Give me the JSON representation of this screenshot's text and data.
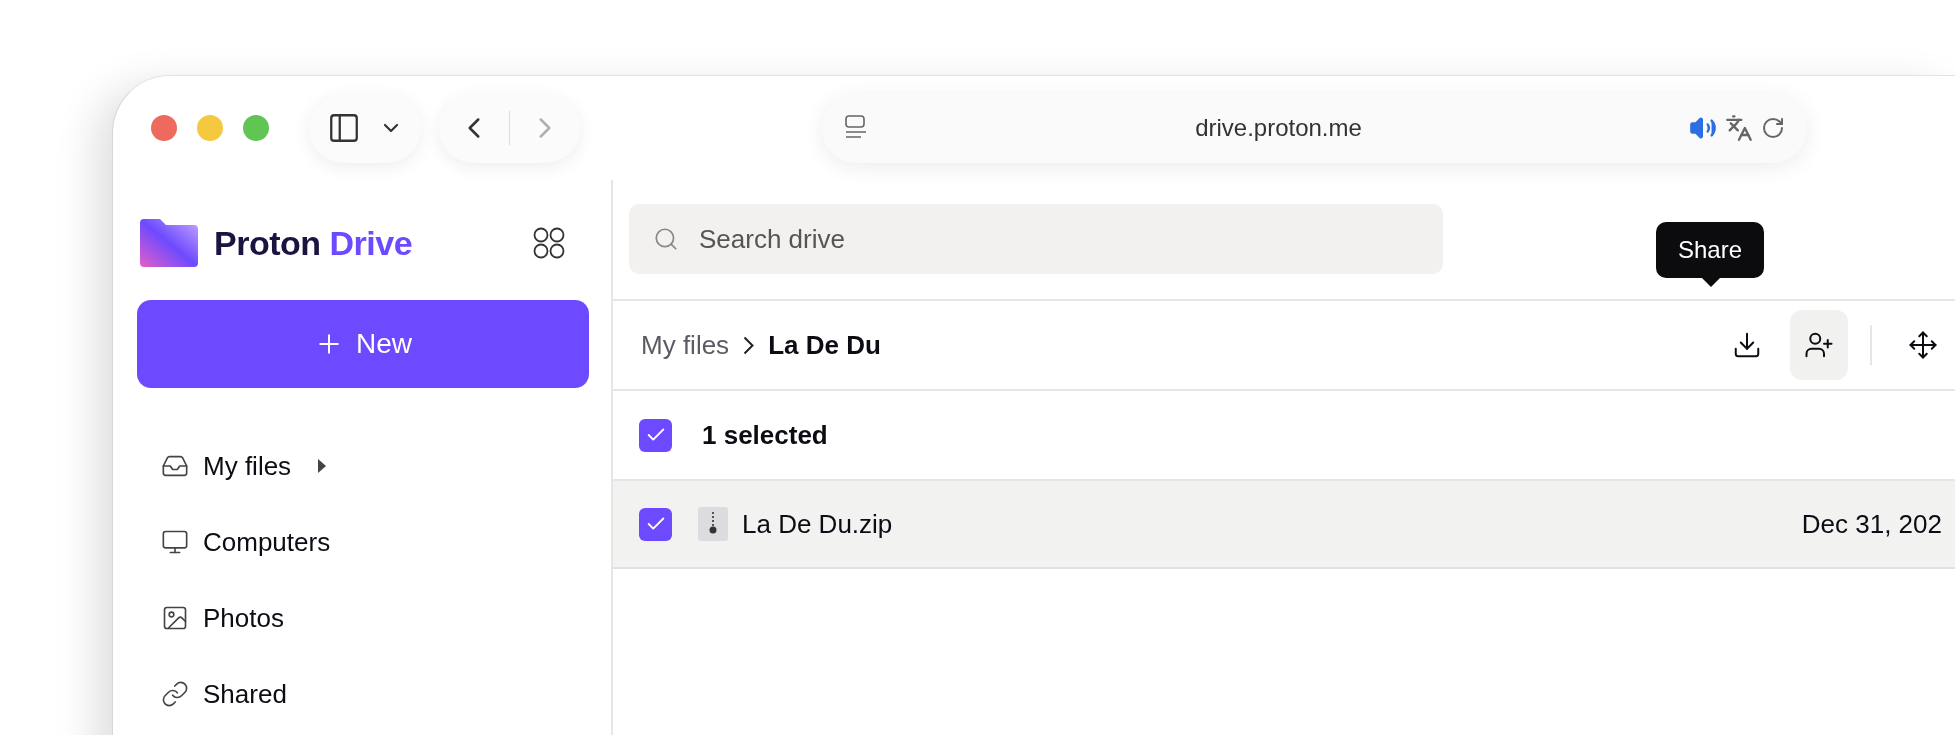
{
  "browser": {
    "address": "drive.proton.me",
    "audio_playing": true
  },
  "sidebar": {
    "brand": {
      "word_1": "Proton",
      "word_2": "Drive"
    },
    "new_button": "New",
    "items": [
      {
        "kind": "files",
        "label": "My files",
        "selected": false,
        "expandable": true
      },
      {
        "kind": "computers",
        "label": "Computers",
        "selected": false,
        "expandable": false
      },
      {
        "kind": "photos",
        "label": "Photos",
        "selected": false,
        "expandable": false
      },
      {
        "kind": "shared",
        "label": "Shared",
        "selected": false,
        "expandable": false
      }
    ]
  },
  "search": {
    "placeholder": "Search drive"
  },
  "breadcrumb": [
    {
      "label": "My files",
      "current": false
    },
    {
      "label": "La De Du",
      "current": true
    }
  ],
  "toolbar": {
    "tooltip": "Share",
    "buttons": [
      {
        "kind": "download",
        "hovered": false
      },
      {
        "kind": "share",
        "hovered": true
      },
      {
        "kind": "move",
        "hovered": false
      }
    ]
  },
  "selection": {
    "checked": true,
    "label": "1 selected"
  },
  "files": [
    {
      "name": "La De Du.zip",
      "checked": true,
      "selected": true,
      "modified": "Dec 31, 202"
    }
  ]
}
